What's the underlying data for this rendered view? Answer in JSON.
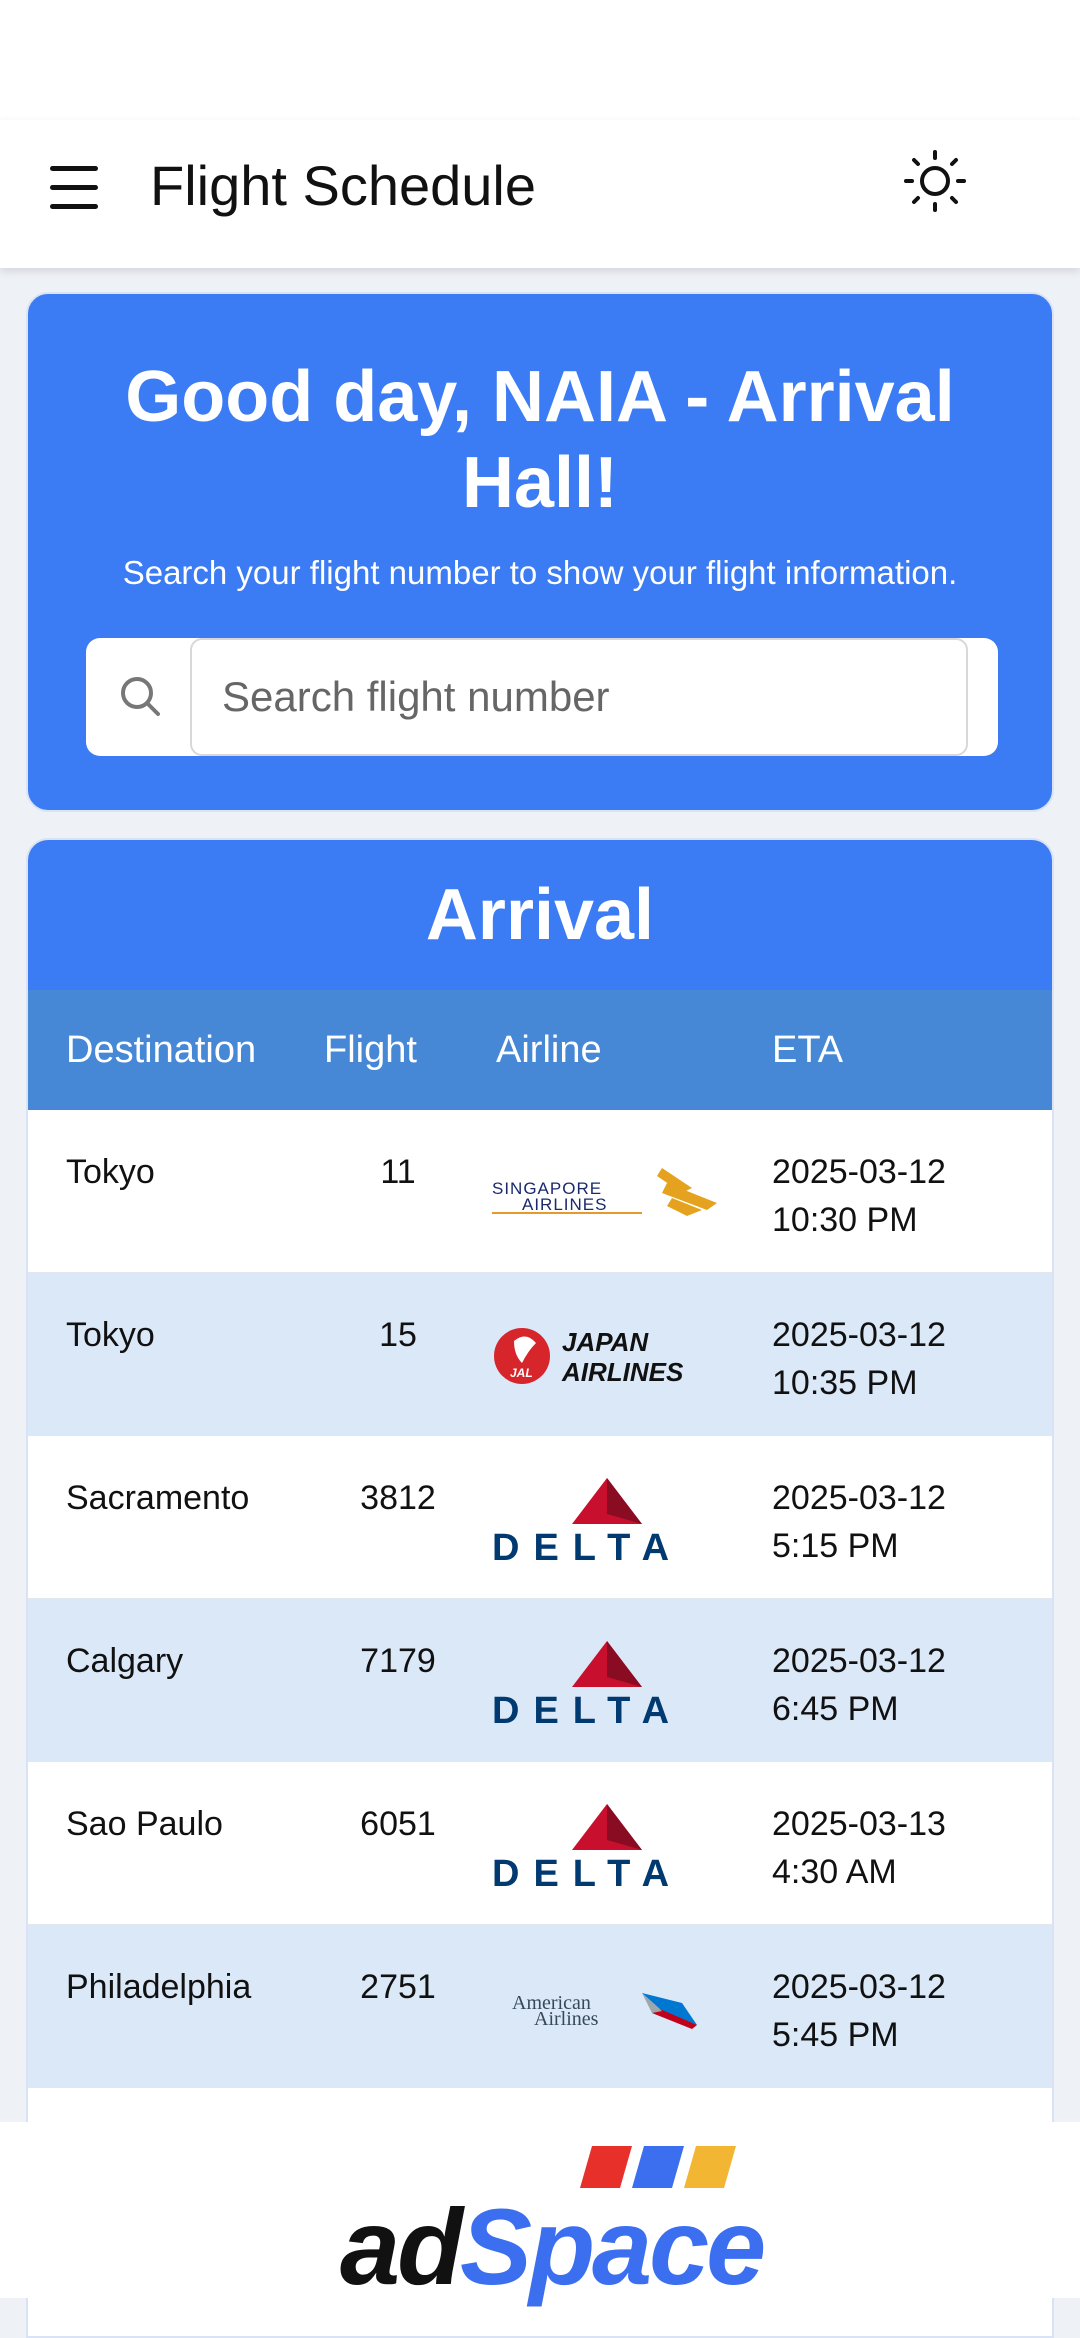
{
  "app_bar": {
    "title": "Flight Schedule"
  },
  "hero": {
    "title": "Good day, NAIA - Arrival Hall!",
    "subtitle": "Search your flight number to show your flight information.",
    "search_placeholder": "Search flight number",
    "search_value": ""
  },
  "arrival": {
    "title": "Arrival",
    "columns": [
      "Destination",
      "Flight",
      "Airline",
      "ETA"
    ],
    "rows": [
      {
        "destination": "Tokyo",
        "flight": "11",
        "airline": "SINGAPORE AIRLINES",
        "eta_date": "2025-03-12",
        "eta_time": "10:30 PM"
      },
      {
        "destination": "Tokyo",
        "flight": "15",
        "airline": "JAPAN AIRLINES",
        "eta_date": "2025-03-12",
        "eta_time": "10:35 PM"
      },
      {
        "destination": "Sacramento",
        "flight": "3812",
        "airline": "DELTA",
        "eta_date": "2025-03-12",
        "eta_time": "5:15 PM"
      },
      {
        "destination": "Calgary",
        "flight": "7179",
        "airline": "DELTA",
        "eta_date": "2025-03-12",
        "eta_time": "6:45 PM"
      },
      {
        "destination": "Sao Paulo",
        "flight": "6051",
        "airline": "DELTA",
        "eta_date": "2025-03-13",
        "eta_time": "4:30 AM"
      },
      {
        "destination": "Philadelphia",
        "flight": "2751",
        "airline": "American Airlines",
        "eta_date": "2025-03-12",
        "eta_time": "5:45 PM"
      }
    ]
  },
  "ad": {
    "part1": "ad",
    "part2": "Space"
  },
  "colors": {
    "primary": "#3b7bf4",
    "header_row": "#4688d6",
    "alt_row": "#dbe8f8"
  },
  "icons": {
    "menu": "hamburger-icon",
    "theme": "sun-icon",
    "search": "search-icon"
  }
}
